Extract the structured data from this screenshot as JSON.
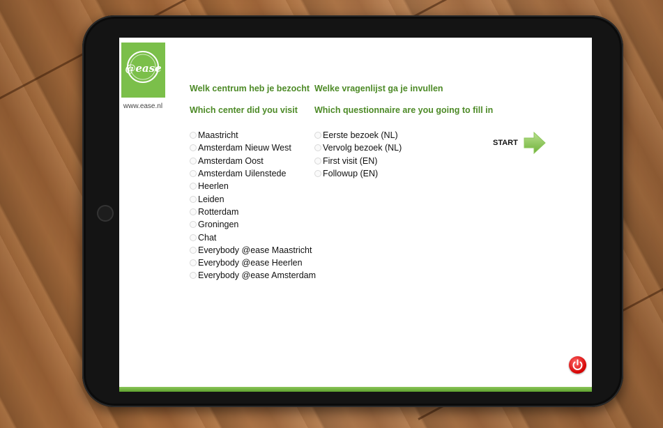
{
  "brand": {
    "logo_text": "@ease",
    "website": "www.ease.nl",
    "accent_color": "#7bbf4a"
  },
  "center_section": {
    "heading_nl": "Welk centrum heb je bezocht",
    "heading_en": "Which center did you visit",
    "options": [
      "Maastricht",
      "Amsterdam Nieuw West",
      "Amsterdam Oost",
      "Amsterdam Uilenstede",
      "Heerlen",
      "Leiden",
      "Rotterdam",
      "Groningen",
      "Chat",
      "Everybody @ease Maastricht",
      "Everybody @ease Heerlen",
      "Everybody @ease Amsterdam"
    ]
  },
  "questionnaire_section": {
    "heading_nl": "Welke vragenlijst ga je invullen",
    "heading_en": "Which questionnaire are you going to fill in",
    "options": [
      "Eerste bezoek (NL)",
      "Vervolg bezoek (NL)",
      "First visit (EN)",
      "Followup (EN)"
    ]
  },
  "actions": {
    "start_label": "START",
    "start_icon": "arrow-right-icon",
    "power_icon": "power-icon",
    "power_color": "#d40000"
  }
}
